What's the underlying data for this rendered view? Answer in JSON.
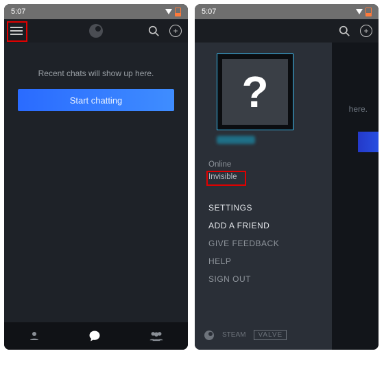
{
  "status": {
    "time": "5:07"
  },
  "left": {
    "empty_message": "Recent chats will show up here.",
    "start_button": "Start chatting"
  },
  "right": {
    "peek_text": "here.",
    "drawer": {
      "status_online": "Online",
      "status_invisible": "Invisible",
      "menu": {
        "settings": "SETTINGS",
        "add_friend": "ADD A FRIEND",
        "feedback": "GIVE FEEDBACK",
        "help": "HELP",
        "signout": "SIGN OUT"
      },
      "footer": {
        "steam": "STEAM",
        "valve": "VALVE"
      }
    }
  }
}
